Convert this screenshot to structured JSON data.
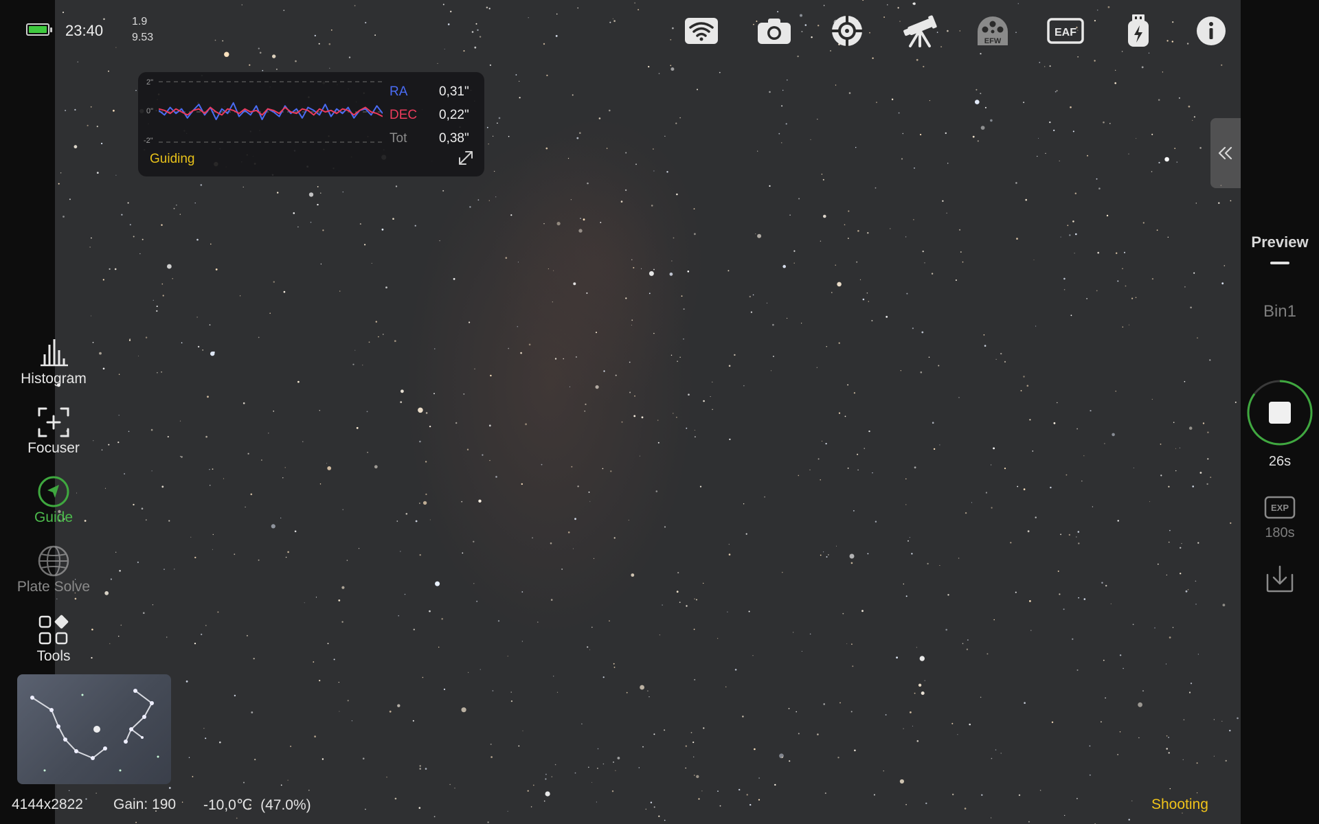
{
  "status": {
    "battery_icon": "battery-icon",
    "time": "23:40",
    "value_top": "1.9",
    "value_bottom": "9.53"
  },
  "top_icons": [
    {
      "name": "wifi-icon"
    },
    {
      "name": "camera-icon"
    },
    {
      "name": "guide-scope-icon"
    },
    {
      "name": "telescope-mount-icon"
    },
    {
      "name": "efw-filter-wheel-icon",
      "label": "EFW"
    },
    {
      "name": "eaf-focuser-icon",
      "label": "EAF"
    },
    {
      "name": "usb-power-icon"
    },
    {
      "name": "info-icon"
    }
  ],
  "guide_panel": {
    "axis_labels": [
      "2\"",
      "0\"",
      "-2\""
    ],
    "rows": [
      {
        "name": "RA",
        "value": "0,31\"",
        "color": "#4a6cf5"
      },
      {
        "name": "DEC",
        "value": "0,22\"",
        "color": "#ec3b5c"
      },
      {
        "name": "Tot",
        "value": "0,38\"",
        "color": "#8c8c8c"
      }
    ],
    "status": "Guiding"
  },
  "chart_data": {
    "type": "line",
    "ylim": [
      -2,
      2
    ],
    "grid": true,
    "series": [
      {
        "name": "RA",
        "color": "#4a6cf5",
        "values": [
          0.1,
          -0.2,
          0.3,
          -0.1,
          0.2,
          -0.4,
          0.1,
          0.5,
          -0.2,
          0.3,
          -0.5,
          0.2,
          -0.1,
          0.6,
          -0.3,
          0.1,
          -0.2,
          0.4,
          -0.5,
          0.2,
          0.0,
          -0.3,
          0.4,
          -0.1,
          0.2,
          -0.4,
          0.3,
          0.1,
          -0.2,
          0.5,
          -0.3,
          0.2,
          -0.1,
          0.3,
          -0.4,
          0.1,
          0.2,
          -0.2,
          0.4,
          -0.1
        ]
      },
      {
        "name": "DEC",
        "color": "#ec3b5c",
        "values": [
          0.2,
          0.1,
          -0.1,
          0.2,
          0.0,
          -0.2,
          0.1,
          0.2,
          -0.1,
          0.3,
          0.0,
          -0.2,
          0.2,
          0.1,
          -0.1,
          0.2,
          0.0,
          0.1,
          -0.2,
          0.2,
          0.1,
          -0.1,
          0.3,
          0.0,
          -0.1,
          0.2,
          0.1,
          -0.2,
          0.2,
          0.0,
          0.1,
          -0.1,
          0.2,
          0.1,
          -0.2,
          0.1,
          0.3,
          0.0,
          -0.1,
          -0.3
        ]
      }
    ]
  },
  "tools": [
    {
      "name": "histogram",
      "label": "Histogram",
      "icon": "histogram-icon",
      "state": "normal"
    },
    {
      "name": "focuser",
      "label": "Focuser",
      "icon": "focuser-icon",
      "state": "normal"
    },
    {
      "name": "guide",
      "label": "Guide",
      "icon": "guide-icon",
      "state": "active"
    },
    {
      "name": "plate-solve",
      "label": "Plate Solve",
      "icon": "globe-icon",
      "state": "disabled"
    },
    {
      "name": "tools",
      "label": "Tools",
      "icon": "tools-grid-icon",
      "state": "normal"
    }
  ],
  "bottom": {
    "resolution": "4144x2822",
    "gain": "Gain: 190",
    "temperature": "-10,0℃  (47.0%)",
    "state": "Shooting"
  },
  "right_panel": {
    "mode": "Preview",
    "bin": "Bin1",
    "countdown": "26s",
    "countdown_progress": 0.85,
    "exp_icon_label": "EXP",
    "exposure": "180s"
  },
  "colors": {
    "accent_green": "#3fa83f",
    "status_yellow": "#f0c31a",
    "sky": "#2f3032"
  }
}
